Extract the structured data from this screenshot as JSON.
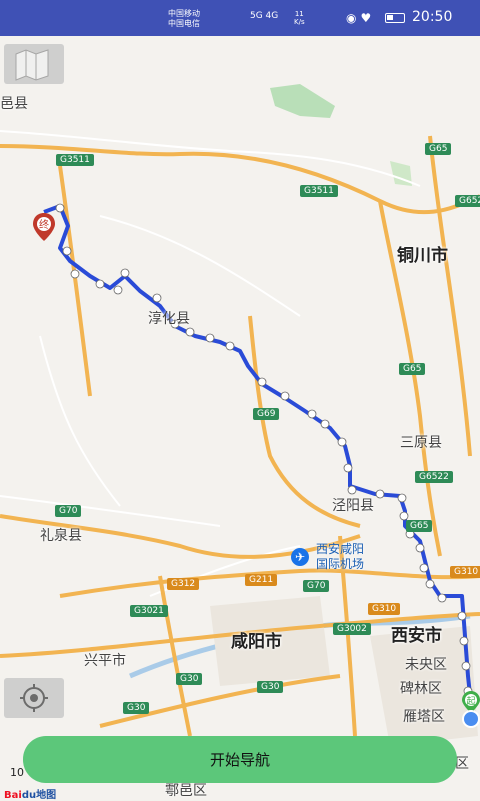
{
  "status_bar": {
    "carrier1": "中国移动",
    "carrier2": "中国电信",
    "network": "5G 4G",
    "speed_value": "11",
    "speed_unit": "K/s",
    "time": "20:50"
  },
  "map": {
    "cities": {
      "tongchuan": "铜川市",
      "xianyang": "咸阳市",
      "xian": "西安市"
    },
    "towns": {
      "top_left": "邑县",
      "chunhua": "淳化县",
      "sanyuan": "三原县",
      "jingyang": "泾阳县",
      "liquan": "礼泉县",
      "xingping": "兴平市",
      "weiyang": "未央区",
      "beilin": "碑林区",
      "yanta": "雁塔区",
      "huyi": "鄠邑区",
      "right_edge": "区"
    },
    "airport": {
      "line1": "西安咸阳",
      "line2": "国际机场"
    },
    "roads": {
      "g3511_a": "G3511",
      "g3511_b": "G3511",
      "g65_a": "G65",
      "g652": "G652",
      "g65_b": "G65",
      "g69": "G69",
      "g6522": "G6522",
      "g65_c": "G65",
      "g70_a": "G70",
      "g310_a": "G310",
      "g312": "G312",
      "g211": "G211",
      "g70_b": "G70",
      "g3021": "G3021",
      "g310_b": "G310",
      "g3002": "G3002",
      "g30_a": "G30",
      "g30_b": "G30",
      "g30_c": "G30"
    },
    "markers": {
      "start": "起",
      "end": "终"
    },
    "scale": "10",
    "logo_main": "Bai",
    "logo_suffix": "du地图"
  },
  "controls": {
    "start_navigation": "开始导航"
  },
  "colors": {
    "status_bar": "#3f51b5",
    "route": "#2a4bd7",
    "highway": "#f2b451",
    "nav_button": "#5cc77a"
  }
}
